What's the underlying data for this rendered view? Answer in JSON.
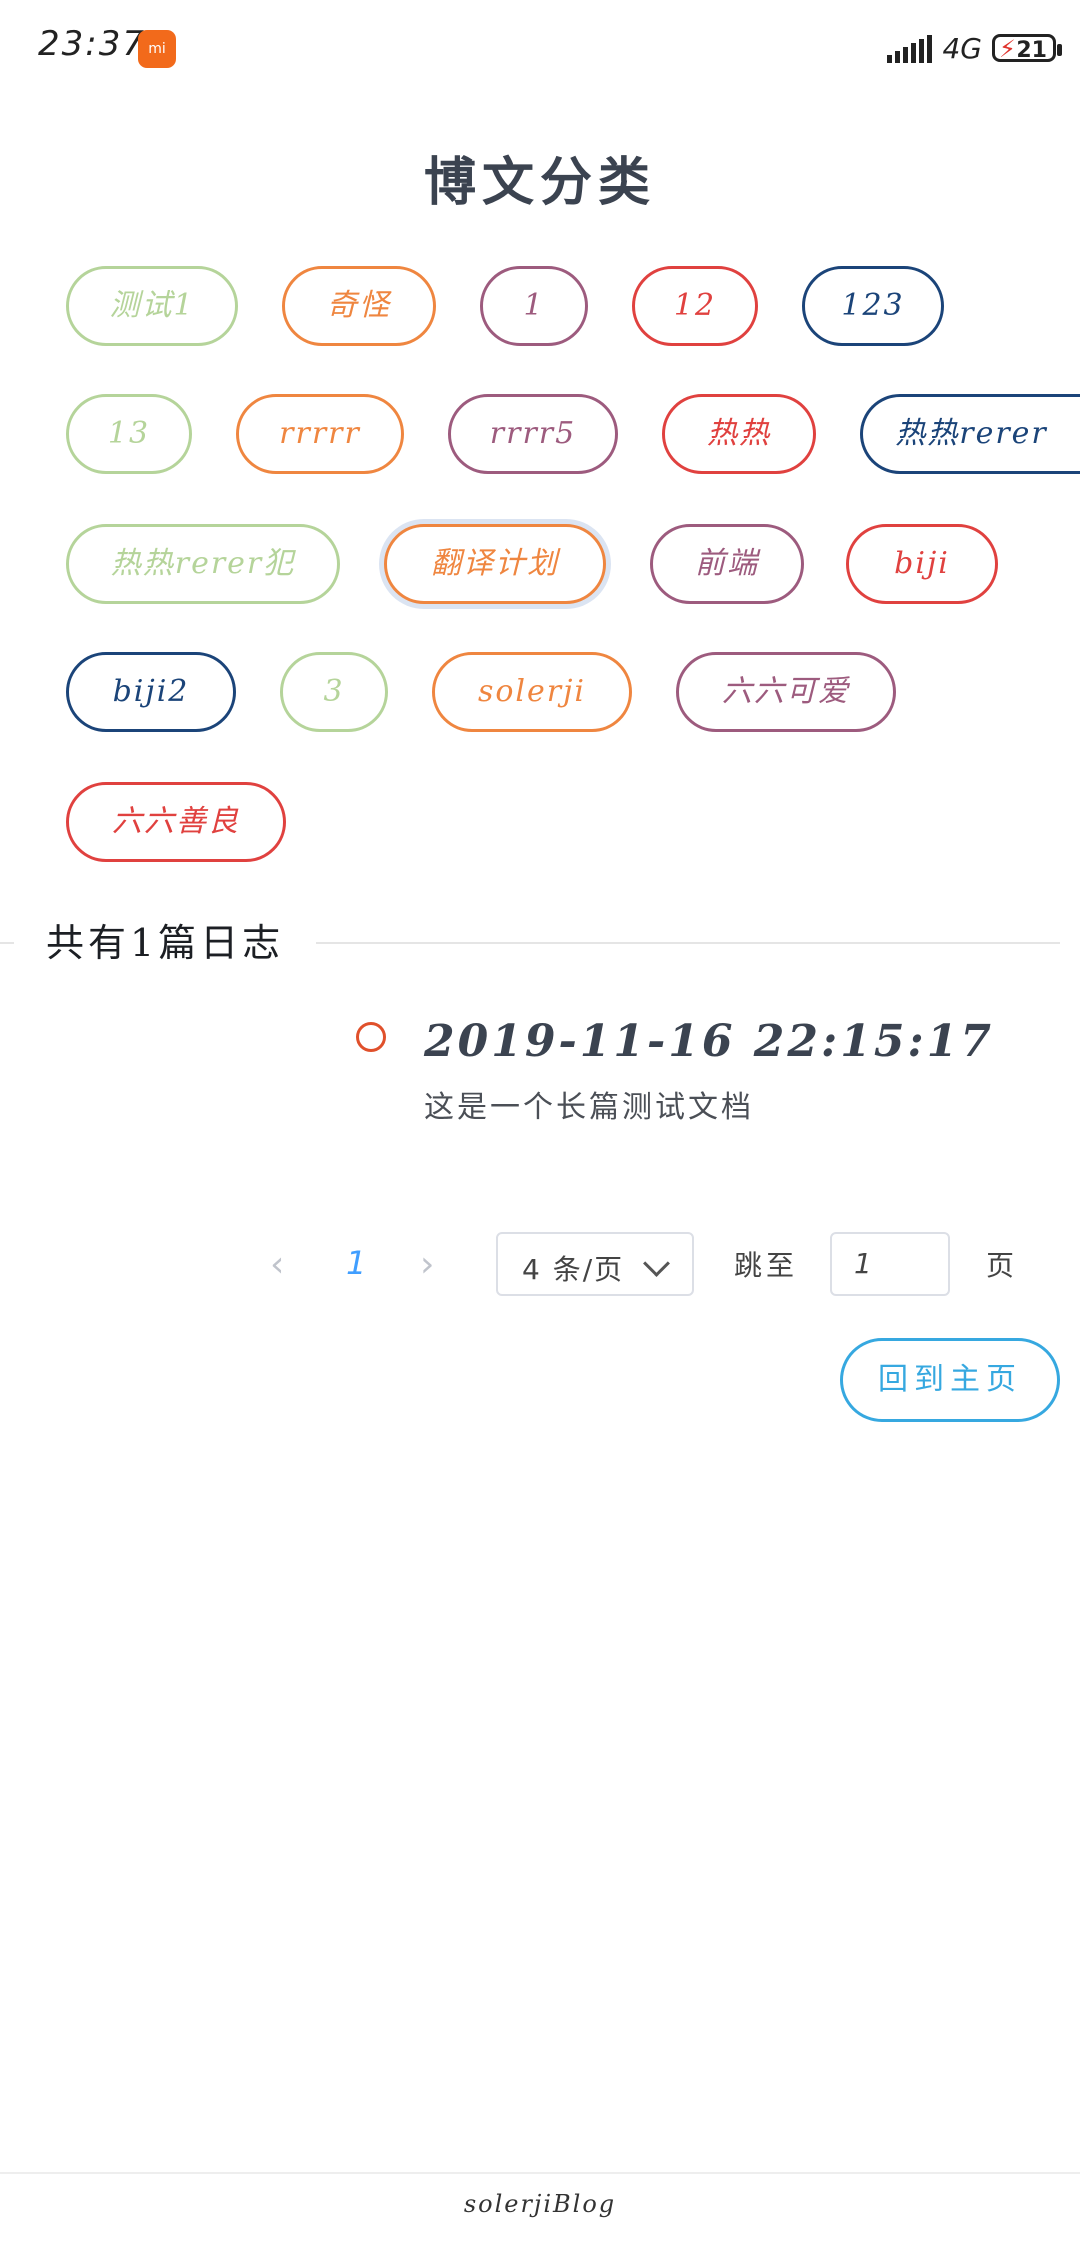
{
  "status_bar": {
    "time": "23:37",
    "network": "4G",
    "battery": "21"
  },
  "page_title": "博文分类",
  "categories": [
    {
      "label": "测试1",
      "color": "#b5d49a"
    },
    {
      "label": "奇怪",
      "color": "#ef8640"
    },
    {
      "label": "1",
      "color": "#9d5b7e"
    },
    {
      "label": "12",
      "color": "#e0413f"
    },
    {
      "label": "123",
      "color": "#1b4479"
    },
    {
      "label": "13",
      "color": "#b5d49a"
    },
    {
      "label": "rrrrr",
      "color": "#ef8640"
    },
    {
      "label": "rrrr5",
      "color": "#9d5b7e"
    },
    {
      "label": "热热",
      "color": "#e0413f"
    },
    {
      "label": "热热rerer",
      "color": "#1b4479"
    },
    {
      "label": "热热rerer犯",
      "color": "#b5d49a"
    },
    {
      "label": "翻译计划",
      "color": "#ef8640",
      "active": true
    },
    {
      "label": "前端",
      "color": "#9d5b7e"
    },
    {
      "label": "biji",
      "color": "#e0413f"
    },
    {
      "label": "biji2",
      "color": "#1b4479"
    },
    {
      "label": "3",
      "color": "#b5d49a"
    },
    {
      "label": "solerji",
      "color": "#ef8640"
    },
    {
      "label": "六六可爱",
      "color": "#9d5b7e"
    },
    {
      "label": "六六善良",
      "color": "#e0413f"
    }
  ],
  "summary": "共有1篇日志",
  "posts": [
    {
      "date": "2019-11-16 22:15:17",
      "title": "这是一个长篇测试文档"
    }
  ],
  "pagination": {
    "prev": "‹",
    "next": "›",
    "current_page": "1",
    "page_size_label": "4 条/页",
    "goto_label": "跳至",
    "goto_value": "1",
    "page_unit": "页"
  },
  "home_button": "回到主页",
  "footer": "solerjiBlog",
  "accent_color": "#36a8e0"
}
